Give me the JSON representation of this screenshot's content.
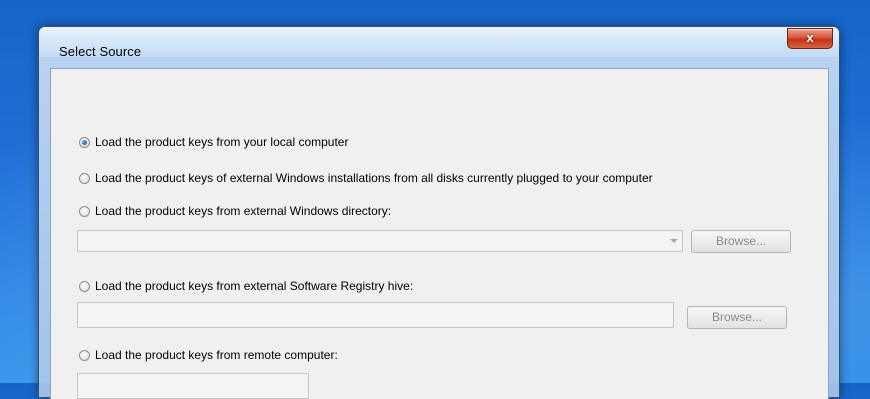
{
  "window": {
    "title": "Select Source",
    "close_label": "x"
  },
  "options": [
    {
      "label": "Load the product keys from your local computer",
      "checked": true
    },
    {
      "label": "Load the product keys of external Windows installations from all disks currently plugged to your computer",
      "checked": false
    },
    {
      "label": "Load the product keys from external Windows directory:",
      "checked": false
    },
    {
      "label": "Load the product keys from external Software Registry hive:",
      "checked": false
    },
    {
      "label": "Load the product keys from remote computer:",
      "checked": false
    }
  ],
  "windows_directory": {
    "value": "",
    "browse_label": "Browse..."
  },
  "registry_hive": {
    "value": "",
    "browse_label": "Browse..."
  },
  "remote_computer": {
    "value": ""
  }
}
